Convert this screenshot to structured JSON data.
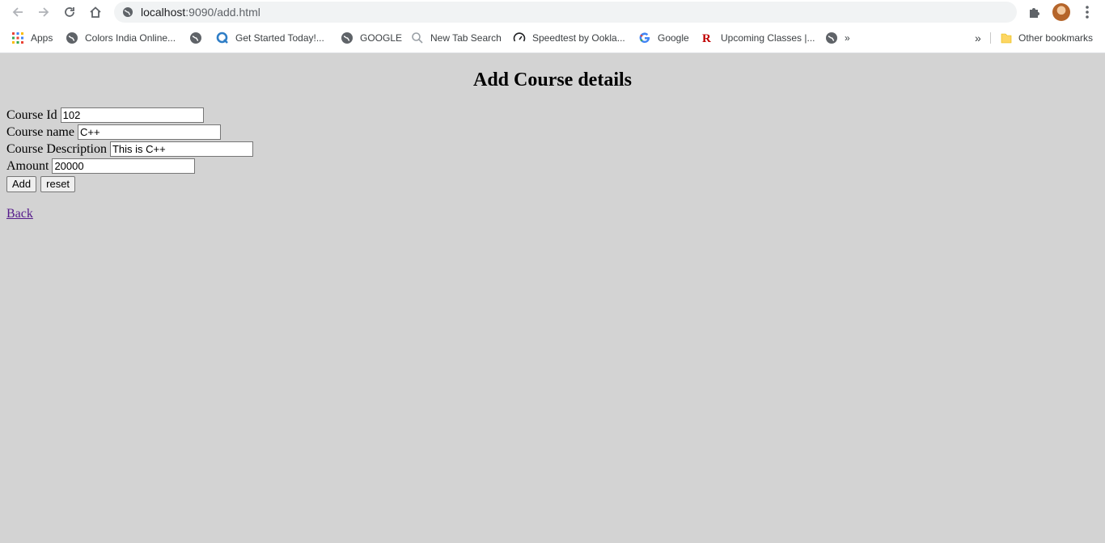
{
  "browser": {
    "url_host": "localhost",
    "url_rest": ":9090/add.html",
    "bookmarks": [
      {
        "label": "Apps",
        "icon": "apps-grid-icon"
      },
      {
        "label": "Colors India Online...",
        "icon": "globe-icon"
      },
      {
        "label": "",
        "icon": "globe-icon"
      },
      {
        "label": "Get Started Today!...",
        "icon": "q-logo-icon"
      },
      {
        "label": "GOOGLE",
        "icon": "globe-icon"
      },
      {
        "label": "New Tab Search",
        "icon": "search-icon"
      },
      {
        "label": "Speedtest by Ookla...",
        "icon": "speedometer-icon"
      },
      {
        "label": "Google",
        "icon": "google-g-icon"
      },
      {
        "label": "Upcoming Classes |...",
        "icon": "r-logo-icon"
      },
      {
        "label": "»",
        "icon": "globe-icon"
      }
    ],
    "overflow_label": "»",
    "other_bookmarks": "Other bookmarks"
  },
  "page": {
    "title": "Add Course details",
    "fields": [
      {
        "label": "Course Id",
        "value": "102"
      },
      {
        "label": "Course name",
        "value": "C++"
      },
      {
        "label": "Course Description",
        "value": "This is C++"
      },
      {
        "label": "Amount",
        "value": "20000"
      }
    ],
    "add_button": "Add",
    "reset_button": "reset",
    "back_link": "Back"
  },
  "colors": {
    "page_background": "#d3d3d3",
    "link_visited": "#551a8b"
  }
}
